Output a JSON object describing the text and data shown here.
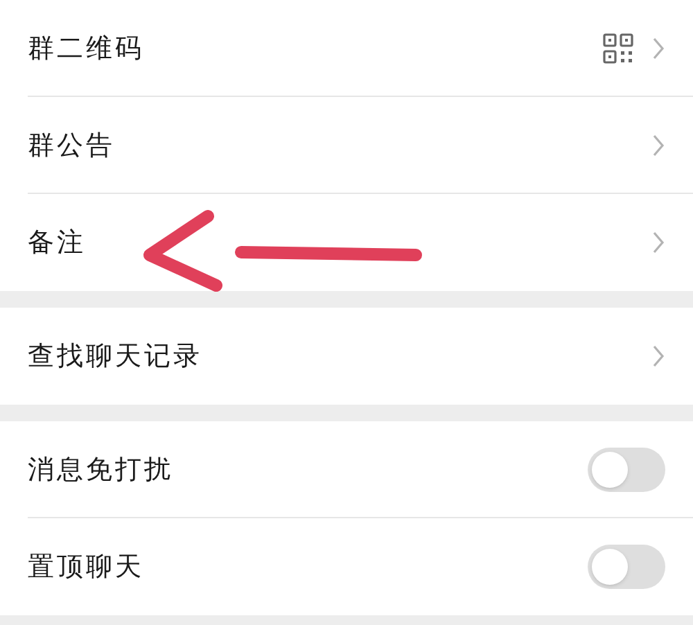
{
  "sections": [
    {
      "rows": [
        {
          "label": "群二维码",
          "kind": "qr"
        },
        {
          "label": "群公告",
          "kind": "link"
        },
        {
          "label": "备注",
          "kind": "link"
        }
      ]
    },
    {
      "rows": [
        {
          "label": "查找聊天记录",
          "kind": "link"
        }
      ]
    },
    {
      "rows": [
        {
          "label": "消息免打扰",
          "kind": "toggle",
          "on": false
        },
        {
          "label": "置顶聊天",
          "kind": "toggle",
          "on": false
        }
      ]
    }
  ]
}
